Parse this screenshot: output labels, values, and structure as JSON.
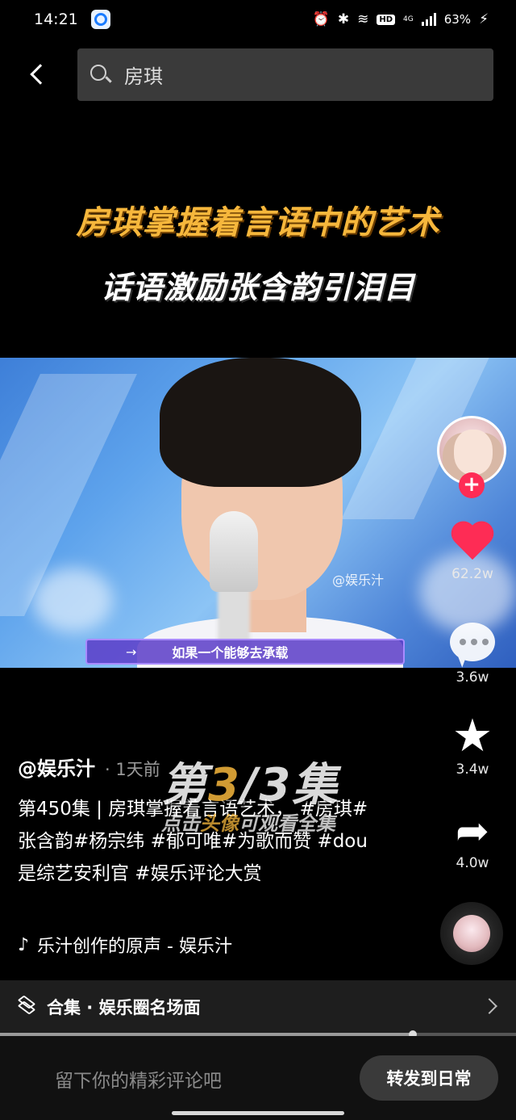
{
  "status_bar": {
    "time": "14:21",
    "battery": "63%",
    "hd": "HD",
    "network": "4G",
    "icons": [
      "alarm-icon",
      "bluetooth-icon",
      "wifi-icon",
      "hd-icon",
      "signal-icon",
      "battery-charging-icon"
    ]
  },
  "search": {
    "query": "房琪"
  },
  "video": {
    "title_line1": "房琪掌握着言语中的艺术",
    "title_line2": "话语激励张含韵引泪目",
    "watermark": "@娱乐汁",
    "subtitle_arrow": "→",
    "subtitle": "如果一个能够去承载",
    "progress": 0.8
  },
  "rail": {
    "likes": "62.2w",
    "comments": "3.6w",
    "favorites": "3.4w",
    "shares": "4.0w",
    "follow_symbol": "+"
  },
  "episode": {
    "prefix": "第",
    "current": "3",
    "separator": "/",
    "total": "3",
    "suffix": "集",
    "sub_pre": "点击",
    "sub_highlight": "头像",
    "sub_post": "可观看全集"
  },
  "post": {
    "author": "@娱乐汁",
    "timestamp": "· 1天前",
    "description": "第450集 | 房琪掌握着言语艺术，  #房琪#张含韵#杨宗纬 #郁可唯#为歌而赞 #dou是综艺安利官 #娱乐评论大赏",
    "sound": "乐汁创作的原声 - 娱乐汁"
  },
  "collection": {
    "label": "合集 · 娱乐圈名场面"
  },
  "bottom": {
    "comment_placeholder": "留下你的精彩评论吧",
    "repost_label": "转发到日常"
  },
  "colors": {
    "accent_red": "#fe2c55",
    "title_gold": "#f6b73c",
    "subtitle_purple": "#a98bff"
  }
}
